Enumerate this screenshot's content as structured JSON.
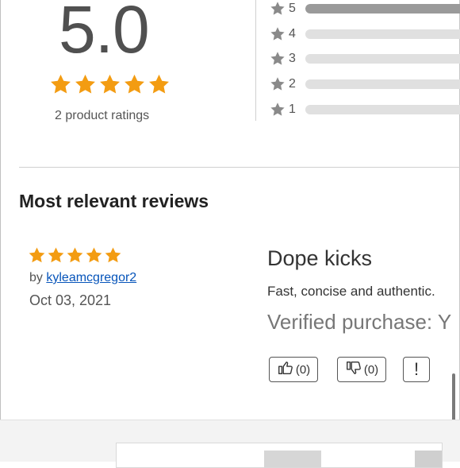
{
  "summary": {
    "average_rating": "5.0",
    "star_value": 5,
    "star_max": 5,
    "ratings_count_text": "2 product ratings"
  },
  "histogram": [
    {
      "stars": "5",
      "fraction": 1.0
    },
    {
      "stars": "4",
      "fraction": 0.0
    },
    {
      "stars": "3",
      "fraction": 0.0
    },
    {
      "stars": "2",
      "fraction": 0.0
    },
    {
      "stars": "1",
      "fraction": 0.0
    }
  ],
  "reviews_section": {
    "title": "Most relevant reviews"
  },
  "review": {
    "rating": 5,
    "by_prefix": "by",
    "reviewer": "kyleamcgregor2",
    "date": "Oct 03, 2021",
    "title": "Dope kicks",
    "body": "Fast, concise and authentic.",
    "verified": "Verified purchase: Y",
    "helpful_count": "(0)",
    "unhelpful_count": "(0)",
    "report_label": "!"
  },
  "colors": {
    "star_gold": "#f39c12",
    "star_gray": "#8a8a8a",
    "link": "#0654ba"
  }
}
